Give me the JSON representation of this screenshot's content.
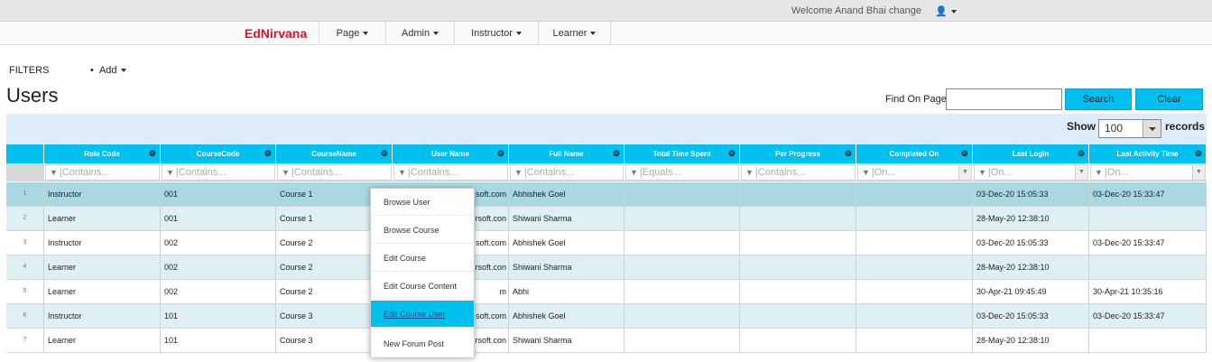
{
  "topbar": {
    "welcome": "Welcome Anand Bhai change",
    "user_icon": "user-icon"
  },
  "nav": {
    "brand": "EdNirvana",
    "items": [
      "Page",
      "Admin",
      "Instructor",
      "Learner"
    ]
  },
  "filters": {
    "label": "FILTERS",
    "add_label": "Add"
  },
  "page": {
    "title": "Users"
  },
  "find": {
    "label": "Find On Page",
    "value": "",
    "search_label": "Search",
    "clear_label": "Clear"
  },
  "grid_toolbar": {
    "show_label": "Show",
    "page_size": "100",
    "records_label": "records"
  },
  "grid": {
    "columns": [
      "Role Code",
      "CourseCode",
      "CourseName",
      "User Name",
      "Full Name",
      "Total Time Spent",
      "Per Progress",
      "Completed On",
      "Last Login",
      "Last Activity Time"
    ],
    "filters": [
      "Contains...",
      "Contains...",
      "Contains...",
      "Contains...",
      "Contains...",
      "Equals...",
      "Contains...",
      "On...",
      "On...",
      "On..."
    ],
    "rows": [
      {
        "num": "1",
        "role": "Instructor",
        "code": "001",
        "course": "Course 1",
        "user": "soft.com",
        "full": "Abhishek Goel",
        "time": "",
        "progress": "",
        "completed": "",
        "login": "03-Dec-20 15:05:33",
        "activity": "03-Dec-20 15:33:47"
      },
      {
        "num": "2",
        "role": "Learner",
        "code": "001",
        "course": "Course 1",
        "user": "rsoft.con",
        "full": "Shiwani Sharma",
        "time": "",
        "progress": "",
        "completed": "",
        "login": "28-May-20 12:38:10",
        "activity": ""
      },
      {
        "num": "3",
        "role": "Instructor",
        "code": "002",
        "course": "Course 2",
        "user": "soft.com",
        "full": "Abhishek Goel",
        "time": "",
        "progress": "",
        "completed": "",
        "login": "03-Dec-20 15:05:33",
        "activity": "03-Dec-20 15:33:47"
      },
      {
        "num": "4",
        "role": "Learner",
        "code": "002",
        "course": "Course 2",
        "user": "rsoft.con",
        "full": "Shiwani Sharma",
        "time": "",
        "progress": "",
        "completed": "",
        "login": "28-May-20 12:38:10",
        "activity": ""
      },
      {
        "num": "5",
        "role": "Learner",
        "code": "002",
        "course": "Course 2",
        "user": "m",
        "full": "Abhi",
        "time": "",
        "progress": "",
        "completed": "",
        "login": "30-Apr-21 09:45:49",
        "activity": "30-Apr-21 10:35:16"
      },
      {
        "num": "6",
        "role": "Instructor",
        "code": "101",
        "course": "Course 3",
        "user": "soft.com",
        "full": "Abhishek Goel",
        "time": "",
        "progress": "",
        "completed": "",
        "login": "03-Dec-20 15:05:33",
        "activity": "03-Dec-20 15:33:47"
      },
      {
        "num": "7",
        "role": "Learner",
        "code": "101",
        "course": "Course 3",
        "user": "rsoft.con",
        "full": "Shiwani Sharma",
        "time": "",
        "progress": "",
        "completed": "",
        "login": "28-May-20 12:38:10",
        "activity": ""
      }
    ]
  },
  "context_menu": {
    "items": [
      "Browse User",
      "Browse Course",
      "Edit Course",
      "Edit Course Content",
      "Edit Course User",
      "New Forum Post"
    ],
    "active_index": 4
  },
  "colors": {
    "accent": "#00c0ef",
    "brand": "#e0102a",
    "row_alt": "#dff0f5",
    "row_selected": "#a8d8e2"
  }
}
